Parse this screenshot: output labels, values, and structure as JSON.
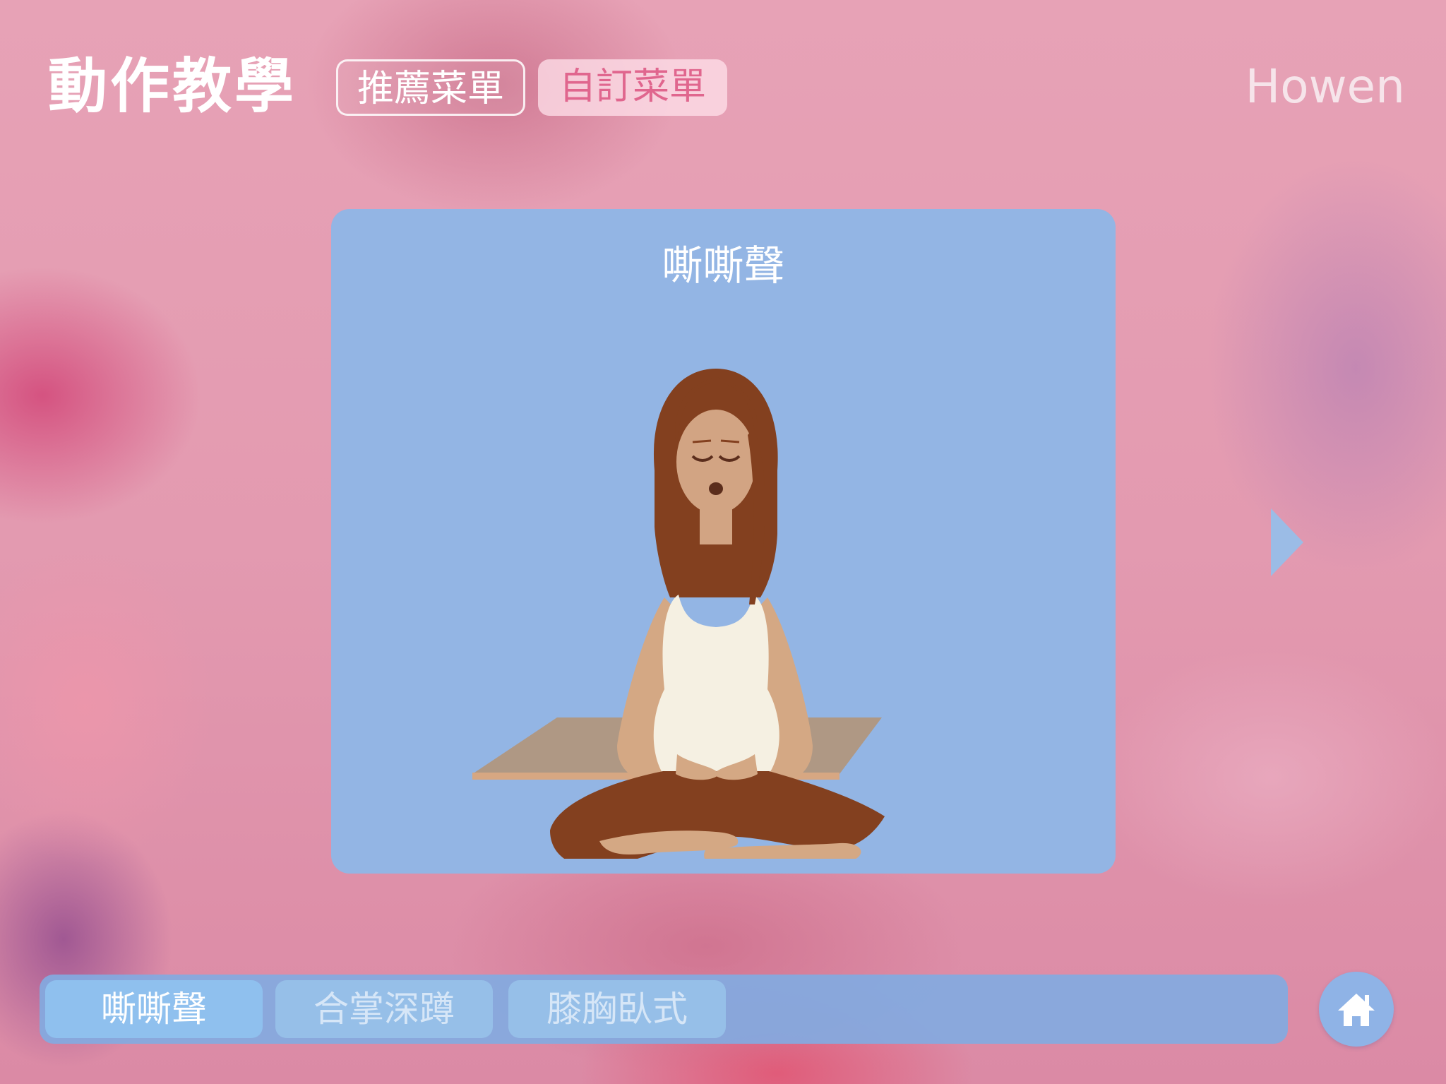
{
  "header": {
    "title": "動作教學",
    "tabs": [
      {
        "label": "推薦菜單",
        "active": false
      },
      {
        "label": "自訂菜單",
        "active": true
      }
    ],
    "user_name": "Howen"
  },
  "card": {
    "title": "嘶嘶聲"
  },
  "bottom_bar": {
    "items": [
      {
        "label": "嘶嘶聲",
        "selected": true
      },
      {
        "label": "合掌深蹲",
        "selected": false
      },
      {
        "label": "膝胸臥式",
        "selected": false
      }
    ]
  },
  "icons": {
    "next": "chevron-right-icon",
    "home": "home-icon"
  },
  "colors": {
    "background": "#e49ab0",
    "card": "#93b5e4",
    "active_tab_text": "#e0668e",
    "bar": "#82aae1",
    "chip_selected": "#8fc0ee"
  }
}
